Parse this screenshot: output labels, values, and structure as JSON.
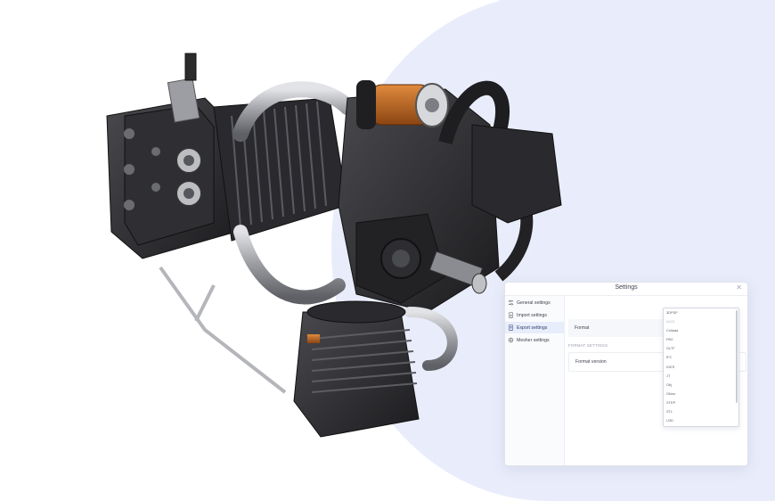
{
  "colors": {
    "background_accent": "#e9edfb",
    "engine_metal": "#2b2b2e",
    "engine_highlight": "#c8c9cc",
    "engine_copper": "#c76a22",
    "active_item_bg": "#e8edfc"
  },
  "dialog": {
    "title": "Settings",
    "close_icon": "close-icon"
  },
  "sidebar": {
    "items": [
      {
        "label": "General settings",
        "icon": "sliders-icon"
      },
      {
        "label": "Import settings",
        "icon": "import-file-icon"
      },
      {
        "label": "Export settings",
        "icon": "export-file-icon",
        "active": true
      },
      {
        "label": "Mesher settings",
        "icon": "mesh-icon"
      }
    ]
  },
  "main": {
    "format_label": "Format",
    "section_label": "FORMAT SETTINGS",
    "format_version_label": "Format version"
  },
  "format_dropdown": {
    "options": [
      "3DPDF",
      "ACIS",
      "Collada",
      "FBX",
      "GLTF",
      "IFC",
      "IGES",
      "JT",
      "Obj",
      "Okino",
      "STEP",
      "STL",
      "U3D"
    ],
    "muted_index": 1
  }
}
